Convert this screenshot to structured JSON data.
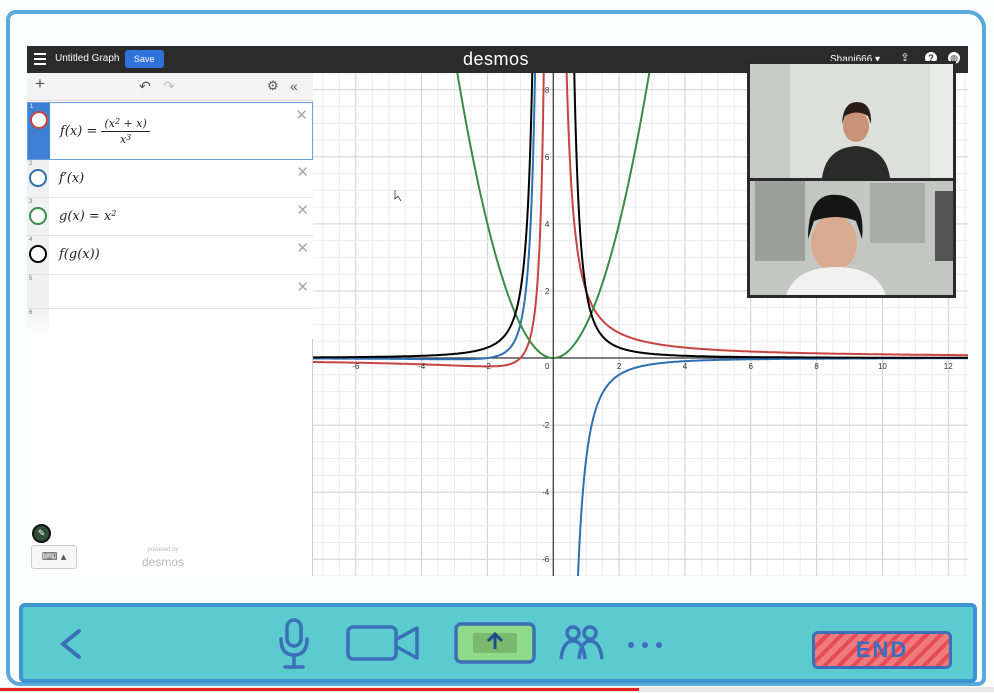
{
  "app": {
    "graph_title": "Untitled Graph",
    "save_label": "Save",
    "brand": "desmos",
    "user": "Shani666 ▾",
    "colors": {
      "topbar": "#2b2b2b",
      "save": "#2f72dc",
      "selected": "#3e80d6"
    }
  },
  "expressions": [
    {
      "index": "1",
      "color": "#c74440",
      "selected": true
    },
    {
      "index": "2",
      "color": "#2d70b3",
      "selected": false,
      "text": "f′(x)"
    },
    {
      "index": "3",
      "color": "#388c46",
      "selected": false,
      "text": "g(x) = x"
    },
    {
      "index": "4",
      "color": "#000000",
      "selected": false,
      "text": "f(g(x))"
    },
    {
      "index": "5",
      "selected": false
    },
    {
      "index": "6",
      "selected": false
    }
  ],
  "expr1": {
    "lhs": "f(x) =",
    "numerator": "(x",
    "num_exp": "2",
    "num_tail": " + x)",
    "denominator": "x",
    "den_exp": "3"
  },
  "expr3_exp": "2",
  "powered": {
    "small": "powered by",
    "brand": "desmos"
  },
  "graph": {
    "x_ticks": [
      "-6",
      "-4",
      "-2",
      "0",
      "2",
      "4",
      "6",
      "8",
      "10",
      "12"
    ],
    "y_ticks": [
      "8",
      "6",
      "4",
      "2",
      "-2",
      "-4",
      "-6"
    ],
    "x_range": [
      -7.3,
      12.6
    ],
    "y_range": [
      -6.5,
      8.5
    ]
  },
  "controls": {
    "end_label": "END",
    "progress": 0.643
  }
}
